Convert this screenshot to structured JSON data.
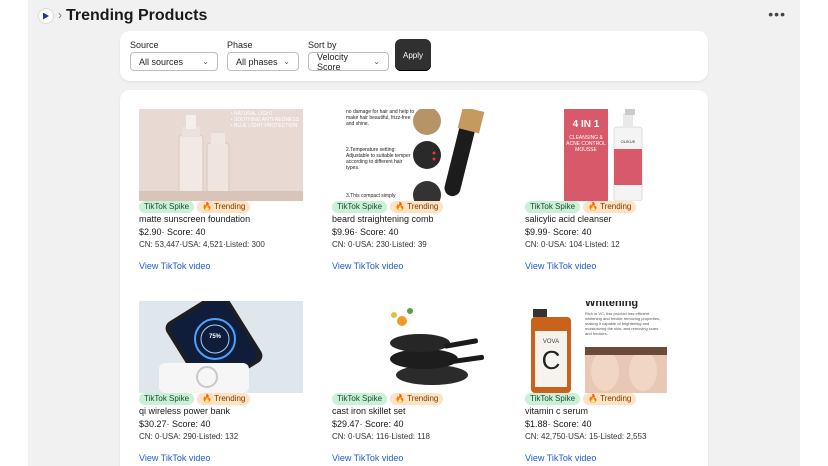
{
  "header": {
    "title": "Trending Products",
    "more_label": "•••"
  },
  "filters": {
    "source": {
      "label": "Source",
      "value": "All sources"
    },
    "phase": {
      "label": "Phase",
      "value": "All phases"
    },
    "sort": {
      "label": "Sort by",
      "value": "Velocity Score"
    },
    "apply_label": "Apply"
  },
  "products": [
    {
      "name": "matte sunscreen foundation",
      "price": "$2.90",
      "score": "· Score: 40",
      "stats": "CN: 53,447·USA: 4,521·Listed: 300",
      "link": "View TikTok video",
      "badge1": "TikTok Spike",
      "badge2": "🔥 Trending"
    },
    {
      "name": "beard straightening comb",
      "price": "$9.96",
      "score": "· Score: 40",
      "stats": "CN: 0·USA: 230·Listed: 39",
      "link": "View TikTok video",
      "badge1": "TikTok Spike",
      "badge2": "🔥 Trending"
    },
    {
      "name": "salicylic acid cleanser",
      "price": "$9.99",
      "score": "· Score: 40",
      "stats": "CN: 0·USA: 104·Listed: 12",
      "link": "View TikTok video",
      "badge1": "TikTok Spike",
      "badge2": "🔥 Trending"
    },
    {
      "name": "qi wireless power bank",
      "price": "$30.27",
      "score": "· Score: 40",
      "stats": "CN: 0·USA: 290·Listed: 132",
      "link": "View TikTok video",
      "badge1": "TikTok Spike",
      "badge2": "🔥 Trending"
    },
    {
      "name": "cast iron skillet set",
      "price": "$29.47",
      "score": "· Score: 40",
      "stats": "CN: 0·USA: 116·Listed: 118",
      "link": "View TikTok video",
      "badge1": "TikTok Spike",
      "badge2": "🔥 Trending"
    },
    {
      "name": "vitamin c serum",
      "price": "$1.88",
      "score": "· Score: 40",
      "stats": "CN: 42,750·USA: 15·Listed: 2,553",
      "link": "View TikTok video",
      "badge1": "TikTok Spike",
      "badge2": "🔥 Trending"
    }
  ],
  "thumb_text": {
    "t1": "• NATURAL LIGHT\n• SOOTHING ANTI-REDNESS\n• BLUE LIGHT PROTECTION",
    "t2a": "no damage for hair and help to make hair beautiful, frizz-free and shine.",
    "t2b": "2.Temperature setting: Adjustable to suitable temper according to different hair types.",
    "t2c": "3.This compact simply",
    "t3a": "4 IN 1",
    "t3b": "CLEANSING & ACNE CONTROL MOUSSE",
    "t3c": "OLIKUE",
    "t4": "75%",
    "t6a": "Whitening",
    "t6b": "VOVA",
    "t6c": "C",
    "t6d": "Rich in VC, this product has efficient whitening and freckle removing properties, making it capable of brightening and moisturizing the skin, and removing scars and freckles."
  }
}
